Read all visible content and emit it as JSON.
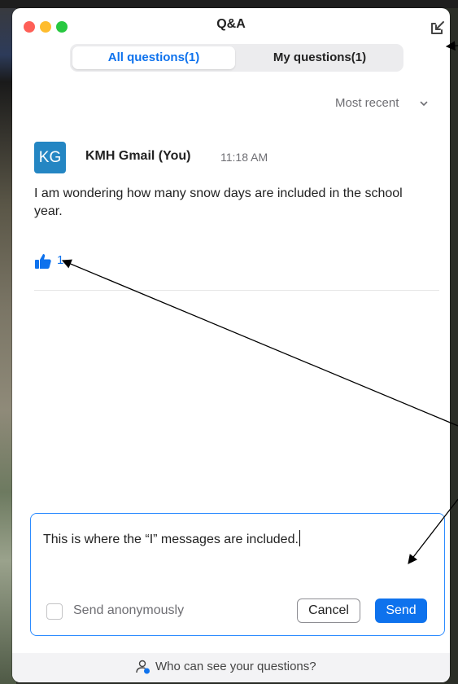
{
  "window": {
    "title": "Q&A"
  },
  "tabs": [
    {
      "label": "All questions(1)",
      "selected": true
    },
    {
      "label": "My questions(1)",
      "selected": false
    }
  ],
  "sort": {
    "label": "Most recent",
    "icon": "chevron-down-icon"
  },
  "question": {
    "avatar_initials": "KG",
    "avatar_color": "#2486c3",
    "author": "KMH Gmail (You)",
    "time": "11:18 AM",
    "text": "I am wondering how many snow days are included in the school year.",
    "likes": "1",
    "like_icon": "thumbs-up-icon"
  },
  "composer": {
    "value": "This is where the “I” messages are included.",
    "anonymous_label": "Send anonymously",
    "anonymous_checked": false,
    "cancel_label": "Cancel",
    "send_label": "Send"
  },
  "footer": {
    "label": "Who can see your questions?",
    "icon": "person-icon"
  },
  "colors": {
    "accent": "#0e72ed",
    "close": "#fe5f57",
    "minimize": "#febc2e",
    "maximize": "#28c840"
  }
}
